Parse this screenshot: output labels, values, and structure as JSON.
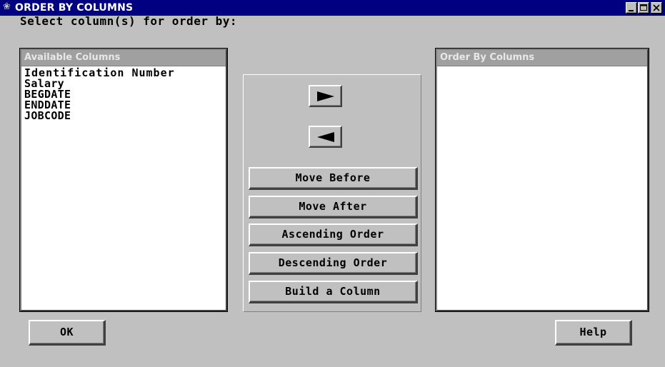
{
  "window": {
    "title": "ORDER BY COLUMNS",
    "icon": "sas-app-icon",
    "controls": [
      "minimize-icon",
      "maximize-icon",
      "close-icon"
    ]
  },
  "prompt": "Select column(s) for order by:",
  "available": {
    "header": "Available Columns",
    "items": [
      "Identification Number",
      "Salary",
      "BEGDATE",
      "ENDDATE",
      "JOBCODE"
    ]
  },
  "order_by": {
    "header": "Order By Columns",
    "items": []
  },
  "actions": {
    "add_icon": "arrow-right-icon",
    "remove_icon": "arrow-left-icon",
    "move_before": "Move Before",
    "move_after": "Move After",
    "ascending": "Ascending Order",
    "descending": "Descending Order",
    "build_column": "Build a Column"
  },
  "footer": {
    "ok": "OK",
    "help": "Help"
  },
  "colors": {
    "titlebar": "#000080",
    "face": "#c0c0c0",
    "list_header": "#a0a0a0"
  }
}
